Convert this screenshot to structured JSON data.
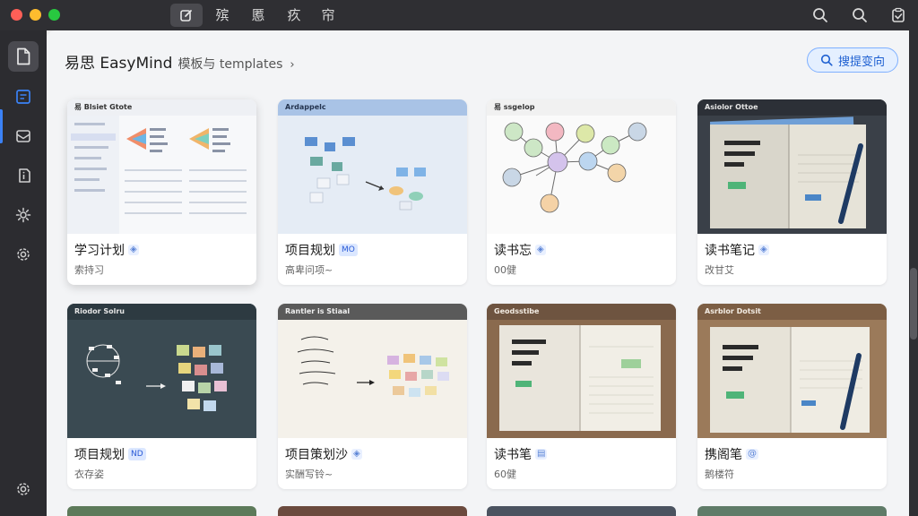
{
  "titlebar": {
    "tabs": [
      {
        "label": "殡"
      },
      {
        "label": "慝"
      },
      {
        "label": "疚"
      },
      {
        "label": "帘"
      }
    ]
  },
  "breadcrumb": {
    "app": "易思 EasyMind",
    "section": "模板与 templates",
    "chevron": "›"
  },
  "search_button": {
    "label": "搜提变向"
  },
  "cards": [
    {
      "title": "学习计划",
      "badge": "◈",
      "subtitle": "索持习",
      "thumb_label": "易 Blsiet Gtote"
    },
    {
      "title": "项目规划",
      "badge": "MO",
      "subtitle": "高卑问项~",
      "thumb_label": "Ardappelc"
    },
    {
      "title": "读书忘",
      "badge": "◈",
      "subtitle": "00健",
      "thumb_label": "易 ssgelop"
    },
    {
      "title": "读书笔记",
      "badge": "◈",
      "subtitle": "改甘艾",
      "thumb_label": "Asiolor Ottoe"
    },
    {
      "title": "项目规划",
      "badge": "ND",
      "subtitle": "衣存姿",
      "thumb_label": "Riodor Solru"
    },
    {
      "title": "项目策划沙",
      "badge": "◈",
      "subtitle": "实酬写铃~",
      "thumb_label": "Rantler is Stiaal"
    },
    {
      "title": "读书笔",
      "badge": "▤",
      "subtitle": "60健",
      "thumb_label": "Geodsstibe"
    },
    {
      "title": "携阁笔",
      "badge": "@",
      "subtitle": "鹅楼符",
      "thumb_label": "Asrblor Dotsit"
    }
  ],
  "colors": {
    "accent": "#3b82f6",
    "sidebar": "#2c2c30",
    "content": "#f3f4f6"
  }
}
